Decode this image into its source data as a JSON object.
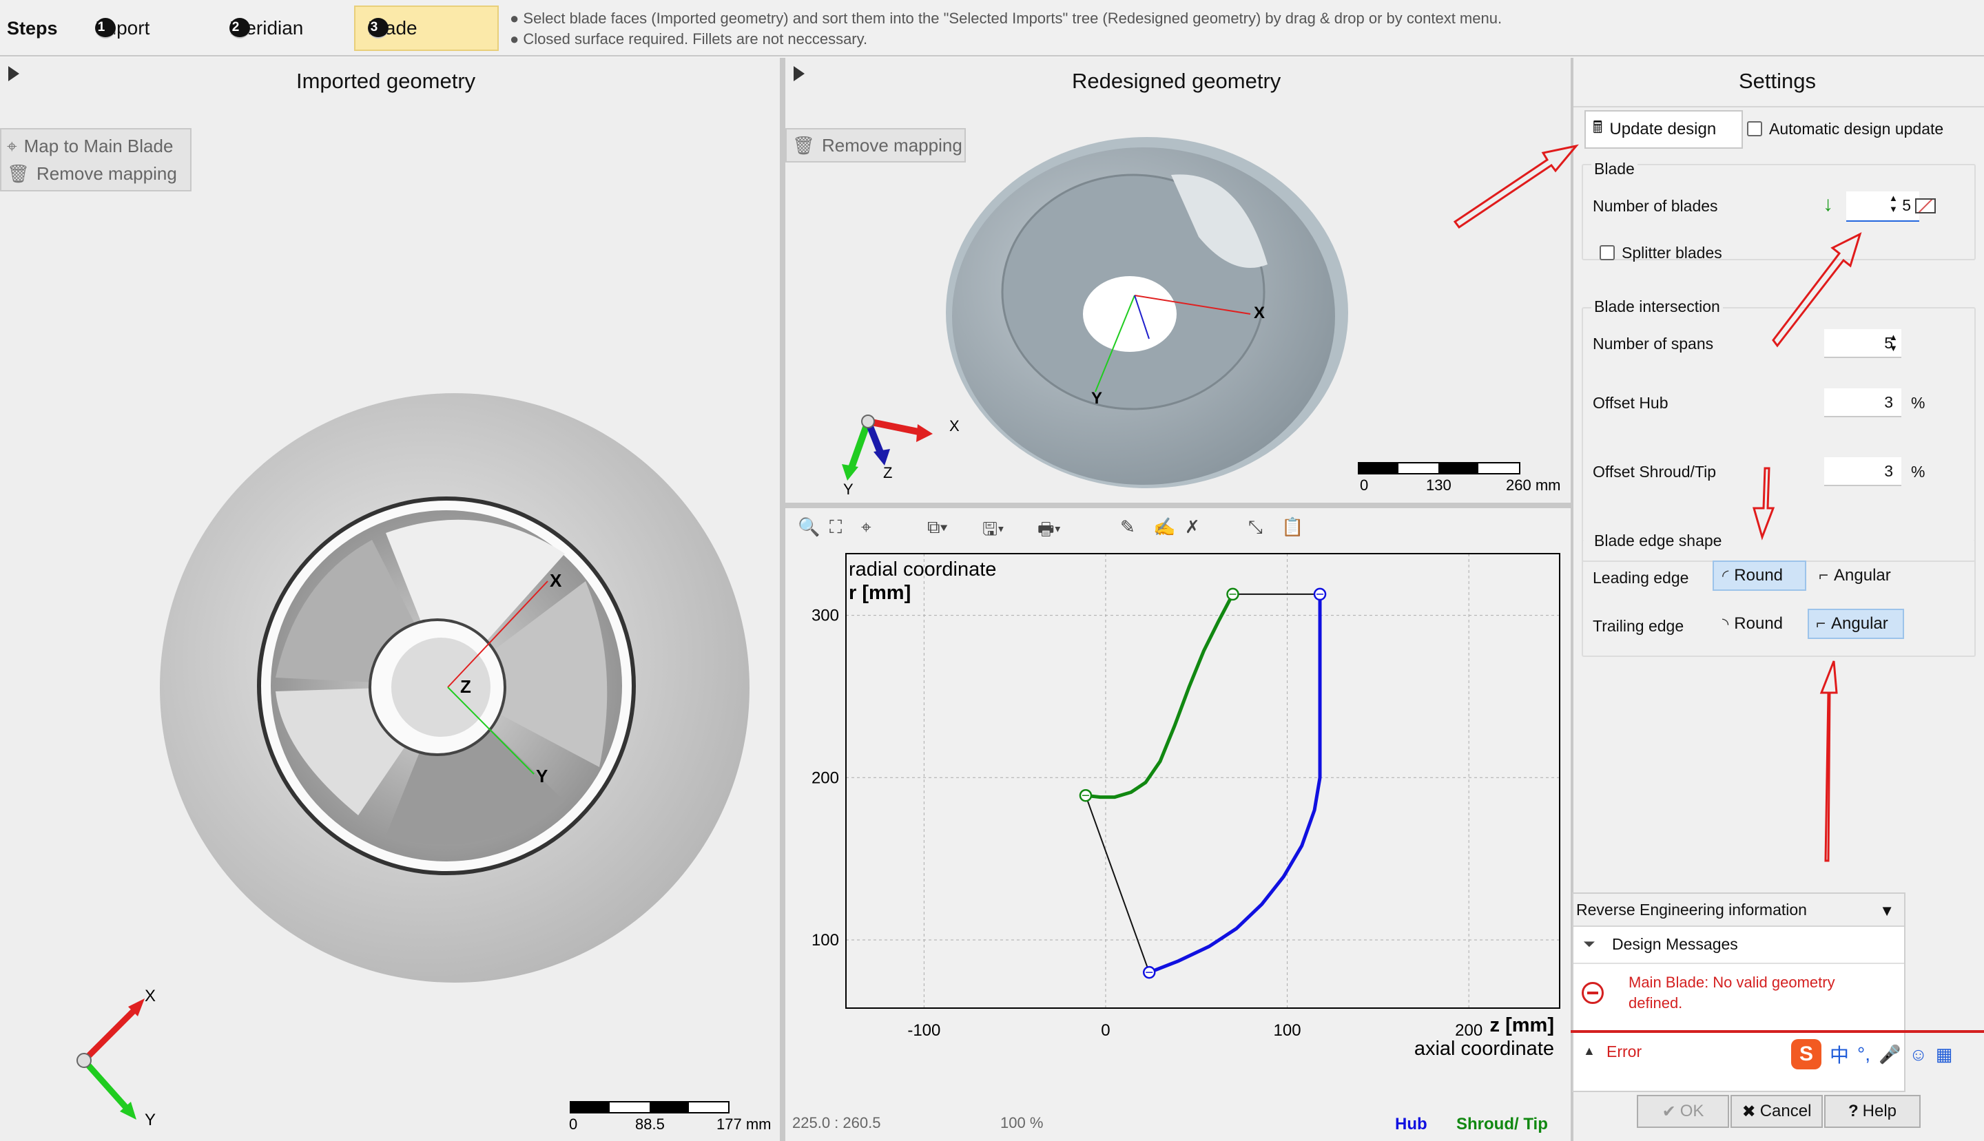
{
  "steps": {
    "title": "Steps",
    "items": [
      {
        "num": "1",
        "label": "Import"
      },
      {
        "num": "2",
        "label": "Meridian"
      },
      {
        "num": "3",
        "label": "Blade"
      }
    ],
    "hint1": "● Select blade faces (Imported geometry) and sort them into the \"Selected Imports\" tree (Redesigned geometry) by drag & drop or by context menu.",
    "hint2": "● Closed surface required. Fillets are not neccessary."
  },
  "imported": {
    "title": "Imported geometry",
    "map_btn": "Map to Main Blade",
    "remove_btn": "Remove mapping",
    "axis": {
      "x": "X",
      "y": "Y",
      "z": "Z"
    },
    "scale": {
      "t0": "0",
      "t1": "88.5",
      "t2": "177 mm"
    }
  },
  "redesigned": {
    "title": "Redesigned geometry",
    "remove_btn": "Remove mapping",
    "axis": {
      "x": "X",
      "y": "Y",
      "z": "Z"
    },
    "scale": {
      "t0": "0",
      "t1": "130",
      "t2": "260 mm"
    }
  },
  "plot": {
    "coords": "225.0 : 260.5",
    "zoom": "100 %",
    "legend_hub": "Hub",
    "legend_shroud": "Shroud/ Tip",
    "hub_color": "#1010e0",
    "shroud_color": "#118811"
  },
  "chart_data": {
    "type": "line",
    "ylabel_top": "radial coordinate",
    "ylabel_unit": "r [mm]",
    "xlabel_unit": "z [mm]",
    "xlabel_bottom": "axial coordinate",
    "xlim": [
      -143,
      250
    ],
    "ylim": [
      58,
      338
    ],
    "xticks": [
      -100,
      0,
      100,
      200
    ],
    "yticks": [
      100,
      200,
      300
    ],
    "grid": true,
    "series": [
      {
        "name": "Shroud/ Tip",
        "color": "#118811",
        "x": [
          -11,
          -3,
          5,
          14,
          22,
          30,
          38,
          46,
          54,
          62,
          70
        ],
        "y": [
          189,
          188,
          188,
          191,
          197,
          210,
          232,
          256,
          278,
          296,
          313
        ]
      },
      {
        "name": "Hub",
        "color": "#1010e0",
        "x": [
          24,
          40,
          57,
          72,
          86,
          98,
          108,
          115,
          118,
          118,
          118,
          118
        ],
        "y": [
          80,
          87,
          96,
          107,
          122,
          139,
          158,
          180,
          200,
          240,
          280,
          313
        ]
      },
      {
        "name": "",
        "color": "#111111",
        "x": [
          -11,
          24
        ],
        "y": [
          189,
          80
        ]
      },
      {
        "name": "",
        "color": "#111111",
        "x": [
          70,
          118
        ],
        "y": [
          313,
          313
        ]
      }
    ],
    "points": [
      {
        "x": -11,
        "y": 189,
        "color": "#118811"
      },
      {
        "x": 70,
        "y": 313,
        "color": "#118811"
      },
      {
        "x": 24,
        "y": 80,
        "color": "#1010e0"
      },
      {
        "x": 118,
        "y": 313,
        "color": "#1010e0"
      }
    ]
  },
  "settings": {
    "title": "Settings",
    "update_btn": "Update design",
    "auto_update": "Automatic design update",
    "blade_group": "Blade",
    "num_blades_label": "Number of blades",
    "num_blades": "5",
    "splitter": "Splitter blades",
    "intersection_group": "Blade intersection",
    "num_spans_label": "Number of spans",
    "num_spans": "5",
    "offset_hub_label": "Offset Hub",
    "offset_hub": "3",
    "offset_shroud_label": "Offset Shroud/Tip",
    "offset_shroud": "3",
    "percent": "%",
    "edge_group": "Blade edge shape",
    "leading_label": "Leading edge",
    "trailing_label": "Trailing edge",
    "round": "Round",
    "angular": "Angular"
  },
  "reverse": {
    "title": "Reverse Engineering information",
    "messages": "Design Messages",
    "error_msg1": "Main Blade: No valid geometry",
    "error_msg2": "defined.",
    "error_label": "Error"
  },
  "dialog": {
    "ok": "OK",
    "cancel": "Cancel",
    "help": "Help"
  },
  "ime": {
    "lang": "中"
  }
}
